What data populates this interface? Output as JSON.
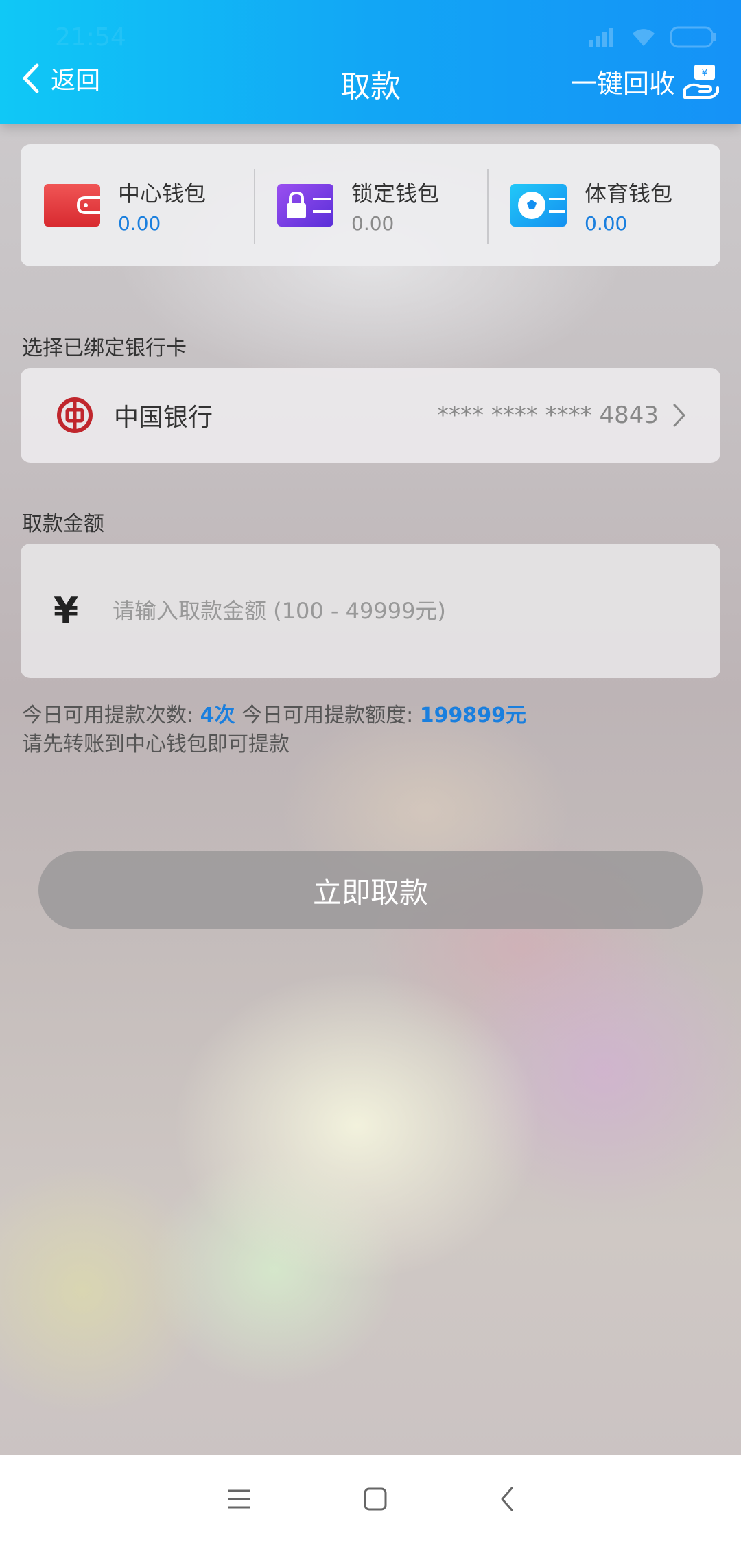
{
  "status_bar": {
    "time": "21:54"
  },
  "header": {
    "back_label": "返回",
    "title": "取款",
    "recycle_label": "一键回收"
  },
  "wallets": [
    {
      "name": "中心钱包",
      "amount": "0.00",
      "amount_color": "#1a7fde",
      "icon": "red-wallet-icon"
    },
    {
      "name": "锁定钱包",
      "amount": "0.00",
      "amount_color": "#8a8a8a",
      "icon": "lock-wallet-icon"
    },
    {
      "name": "体育钱包",
      "amount": "0.00",
      "amount_color": "#1a7fde",
      "icon": "soccer-wallet-icon"
    }
  ],
  "bank_section": {
    "label": "选择已绑定银行卡",
    "bank_name": "中国银行",
    "card_number": "**** **** **** 4843"
  },
  "amount_section": {
    "label": "取款金额",
    "currency_symbol": "¥",
    "placeholder": "请输入取款金额 (100 - 49999元)",
    "value": ""
  },
  "info": {
    "times_label": "今日可用提款次数:",
    "times_value": "4次",
    "quota_label": "今日可用提款额度:",
    "quota_value": "199899元",
    "hint": "请先转账到中心钱包即可提款"
  },
  "submit_label": "立即取款",
  "colors": {
    "header_start": "#10c8f6",
    "header_end": "#1592f7",
    "accent": "#1a7fde"
  }
}
